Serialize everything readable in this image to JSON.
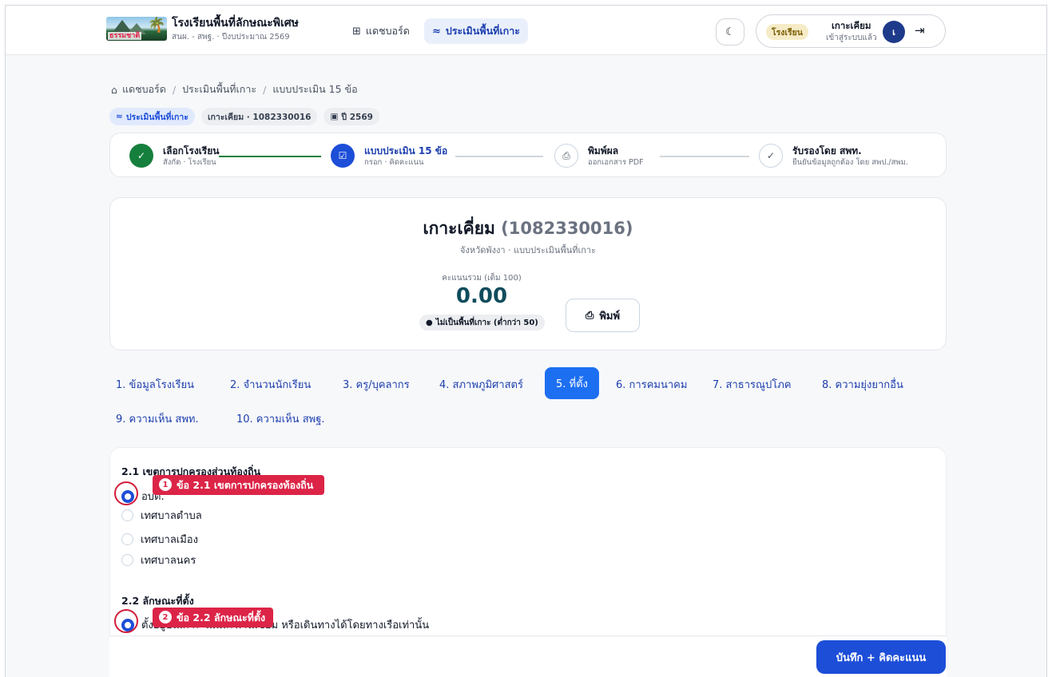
{
  "header": {
    "logo_text": "ธรรมชาติ",
    "brand_title": "โรงเรียนพื้นที่ลักษณะพิเศษ",
    "brand_subtitle": "สนผ. - สพฐ. · ปีงบประมาณ 2569",
    "nav": [
      {
        "label": "แดชบอร์ด",
        "icon": "grid-icon",
        "active": false
      },
      {
        "label": "ประเมินพื้นที่เกาะ",
        "icon": "waves-icon",
        "active": true
      }
    ],
    "theme_icon": "moon-icon",
    "user": {
      "role": "โรงเรียน",
      "name": "เกาะเคียม",
      "status": "เข้าสู่ระบบแล้ว",
      "avatar_initial": "เ",
      "logout_icon": "logout-icon"
    }
  },
  "breadcrumb": {
    "home_icon": "home-icon",
    "items": [
      "แดชบอร์ด",
      "ประเมินพื้นที่เกาะ",
      "แบบประเมิน 15 ข้อ"
    ]
  },
  "chips": [
    {
      "label": "ประเมินพื้นที่เกาะ",
      "icon": "waves-icon"
    },
    {
      "label": "เกาะเคียม · 1082330016"
    },
    {
      "label": "ปี 2569",
      "icon": "calendar-icon"
    }
  ],
  "stepper": [
    {
      "title": "เลือกโรงเรียน",
      "subtitle": "สังกัด · โรงเรียน",
      "state": "done"
    },
    {
      "title": "แบบประเมิน 15 ข้อ",
      "subtitle": "กรอก · คิดคะแนน",
      "state": "current"
    },
    {
      "title": "พิมพ์ผล",
      "subtitle": "ออกเอกสาร PDF",
      "state": "todo"
    },
    {
      "title": "รับรองโดย สพท.",
      "subtitle": "ยืนยันข้อมูลถูกต้อง โดย สพป./สพม.",
      "state": "todo"
    }
  ],
  "summary": {
    "school_name": "เกาะเคี่ยม",
    "school_code": "(1082330016)",
    "subtitle": "จังหวัดพังงา · แบบประเมินพื้นที่เกาะ",
    "score_label": "คะแนนรวม (เต็ม 100)",
    "score_value": "0.00",
    "status_badge": "ไม่เป็นพื้นที่เกาะ (ต่ำกว่า 50)",
    "print_label": "พิมพ์"
  },
  "tabs": [
    "1. ข้อมูลโรงเรียน",
    "2. จำนวนนักเรียน",
    "3. ครู/บุคลากร",
    "4. สภาพภูมิศาสตร์",
    "5. ที่ตั้ง",
    "6. การคมนาคม",
    "7. สาธารณูปโภค",
    "8. ความยุ่งยากอื่น",
    "9. ความเห็น สพท.",
    "10. ความเห็น สพฐ."
  ],
  "active_tab": "5. ที่ตั้ง",
  "questions": [
    {
      "title": "2.1 เขตการปกครองส่วนท้องถิ่น",
      "options": [
        "อบต.",
        "เทศบาลตำบล",
        "เทศบาลเมือง",
        "เทศบาลนคร"
      ],
      "selected_index": 0
    },
    {
      "title": "2.2 ลักษณะที่ตั้ง",
      "options": [
        "ตั้งอยู่บนเกาะ ไม่มีสะพานเชื่อม หรือเดินทางได้โดยทางเรือเท่านั้น"
      ],
      "selected_index": 0
    }
  ],
  "callouts": [
    {
      "number": "1",
      "text": "ข้อ 2.1 เขตการปกครองท้องถิ่น"
    },
    {
      "number": "2",
      "text": "ข้อ 2.2 ลักษณะที่ตั้ง"
    }
  ],
  "footer": {
    "save_label": "บันทึก + คิดคะแนน"
  },
  "colors": {
    "primary": "#1d4ed8",
    "success": "#15803d",
    "callout": "#dc2447"
  }
}
